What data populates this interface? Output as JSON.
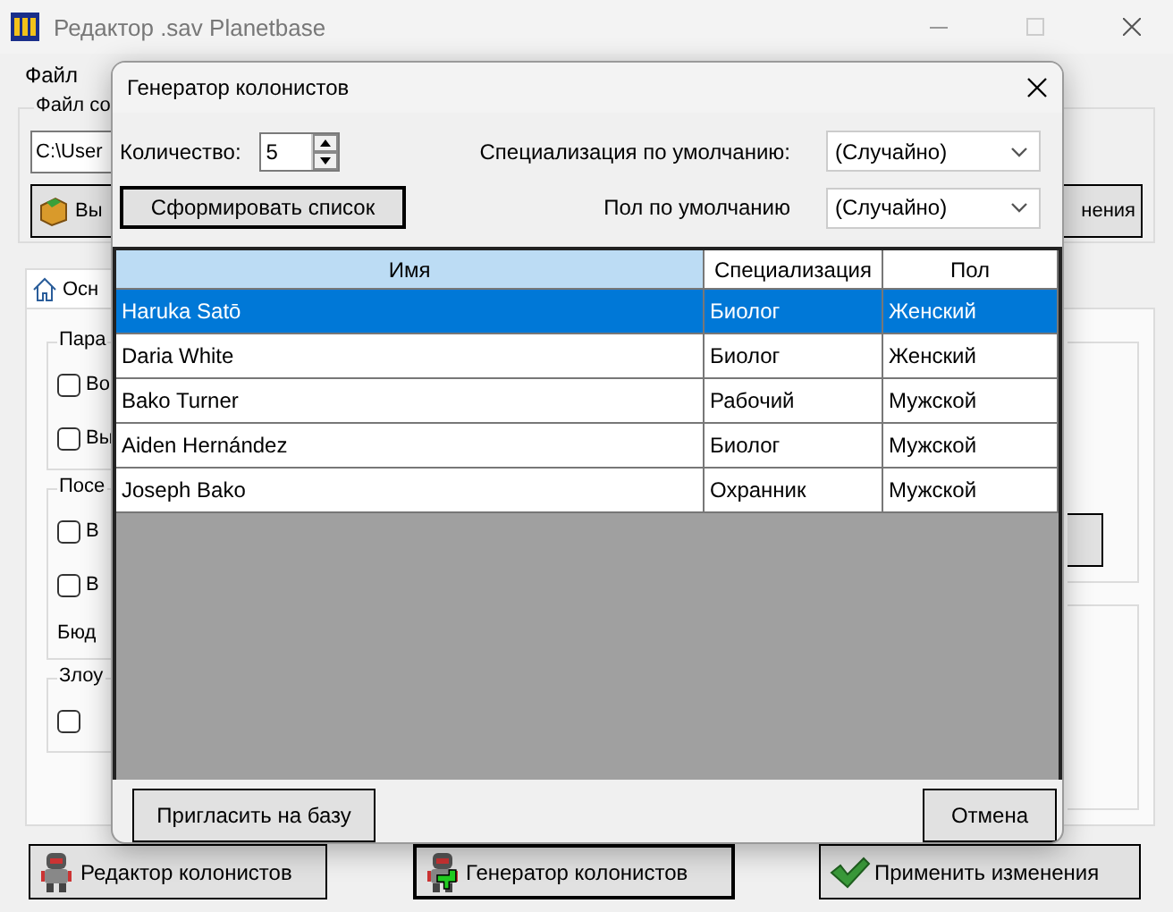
{
  "window": {
    "title": "Редактор .sav Planetbase"
  },
  "menu": [
    {
      "label": "Файл"
    }
  ],
  "file_group": {
    "label": "Файл со",
    "path": "C:\\User",
    "open_button": "Вы",
    "save_button": "нения"
  },
  "tabs": [
    {
      "label": "Осн",
      "selected": true
    }
  ],
  "groups": [
    {
      "label": "Пара",
      "checkboxes": [
        {
          "label": "Во",
          "checked": false
        },
        {
          "label": "Вы",
          "checked": false
        }
      ]
    },
    {
      "label": "Посе",
      "checkboxes": [
        {
          "label": "В",
          "checked": false
        },
        {
          "label": "В",
          "checked": false
        }
      ],
      "note": "Бюд"
    },
    {
      "label": "Злоу",
      "checkboxes": [
        {
          "checked": false
        }
      ]
    }
  ],
  "bottom_buttons": [
    {
      "label": "Редактор колонистов",
      "kind": "colonist",
      "focused": false
    },
    {
      "label": "Генератор колонистов",
      "kind": "colonist-add",
      "focused": true
    },
    {
      "label": "Применить изменения",
      "kind": "apply",
      "focused": false
    }
  ],
  "dialog": {
    "title": "Генератор колонистов",
    "quantity_label": "Количество:",
    "quantity": "5",
    "generate_button": "Сформировать список",
    "specialization_label": "Специализация по умолчанию:",
    "specialization": "(Случайно)",
    "gender_label": "Пол по умолчанию",
    "gender": "(Случайно)",
    "table": {
      "columns": [
        {
          "label": "Имя",
          "highlighted": true
        },
        {
          "label": "Специализация",
          "highlighted": false
        },
        {
          "label": "Пол",
          "highlighted": false
        }
      ],
      "rows": [
        {
          "cells": [
            "Haruka Satō",
            "Биолог",
            "Женский"
          ],
          "selected": true
        },
        {
          "cells": [
            "Daria White",
            "Биолог",
            "Женский"
          ],
          "selected": false
        },
        {
          "cells": [
            "Bako Turner",
            "Рабочий",
            "Мужской"
          ],
          "selected": false
        },
        {
          "cells": [
            "Aiden Hernández",
            "Биолог",
            "Мужской"
          ],
          "selected": false
        },
        {
          "cells": [
            "Joseph Bako",
            "Охранник",
            "Мужской"
          ],
          "selected": false
        }
      ]
    },
    "invite_button": "Пригласить на базу",
    "cancel_button": "Отмена"
  }
}
